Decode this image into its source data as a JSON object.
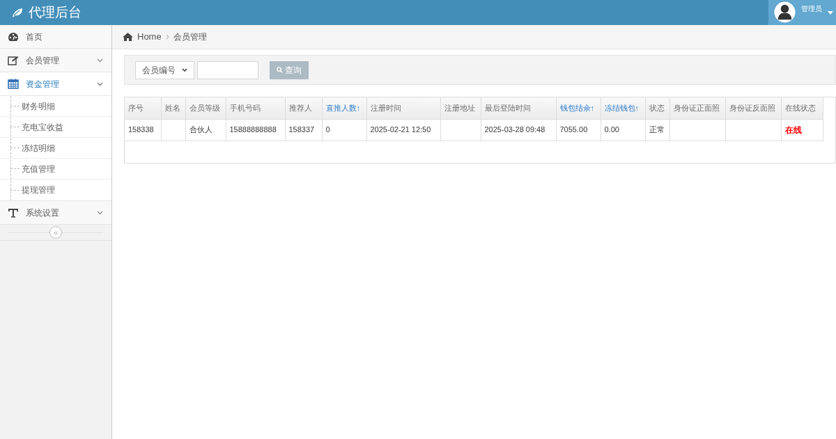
{
  "header": {
    "title": "代理后台",
    "user": "管理员"
  },
  "sidebar": {
    "items": [
      {
        "label": "首页",
        "kind": "dashboard",
        "selected": false
      },
      {
        "label": "会员管理",
        "kind": "edit",
        "selected": false,
        "expanded": false
      },
      {
        "label": "资金管理",
        "kind": "calendar",
        "selected": true,
        "expanded": true,
        "children": [
          {
            "label": "财务明细"
          },
          {
            "label": "充电宝收益"
          },
          {
            "label": "冻结明细"
          },
          {
            "label": "充值管理"
          },
          {
            "label": "提现管理"
          }
        ]
      },
      {
        "label": "系统设置",
        "kind": "text",
        "selected": false,
        "expanded": false
      }
    ],
    "collapse": "«"
  },
  "breadcrumb": [
    "Home",
    "会员管理"
  ],
  "search": {
    "field_select": "会员编号",
    "button": "查询"
  },
  "table": {
    "columns": [
      {
        "label": "序号",
        "sortable": false
      },
      {
        "label": "姓名",
        "sortable": false
      },
      {
        "label": "会员等级",
        "sortable": false
      },
      {
        "label": "手机号码",
        "sortable": false
      },
      {
        "label": "推荐人",
        "sortable": false
      },
      {
        "label": "直推人数↑",
        "sortable": true
      },
      {
        "label": "注册时间",
        "sortable": false
      },
      {
        "label": "注册地址",
        "sortable": false
      },
      {
        "label": "最后登陆时间",
        "sortable": false
      },
      {
        "label": "钱包结余↑",
        "sortable": true
      },
      {
        "label": "冻结钱包↑",
        "sortable": true
      },
      {
        "label": "状态",
        "sortable": false
      },
      {
        "label": "身份证正面照",
        "sortable": false
      },
      {
        "label": "身份证反面照",
        "sortable": false
      },
      {
        "label": "在线状态",
        "sortable": false
      }
    ],
    "rows": [
      {
        "cells": [
          {
            "text": "158338"
          },
          {
            "text": ""
          },
          {
            "text": "合伙人"
          },
          {
            "text": "15888888888"
          },
          {
            "text": "158337"
          },
          {
            "text": "0"
          },
          {
            "text": "2025-02-21 12:50"
          },
          {
            "text": ""
          },
          {
            "text": "2025-03-28 09:48"
          },
          {
            "text": "7055.00"
          },
          {
            "text": "0.00"
          },
          {
            "text": "正常"
          },
          {
            "text": ""
          },
          {
            "text": ""
          },
          {
            "text": "在线",
            "color": "#ff0000"
          }
        ]
      }
    ]
  }
}
